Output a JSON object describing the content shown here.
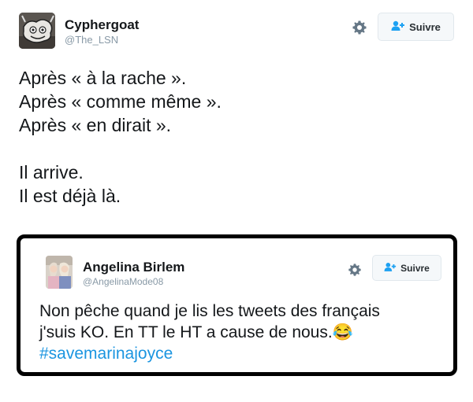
{
  "tweet": {
    "user": {
      "name": "Cyphergoat",
      "handle": "@The_LSN"
    },
    "follow_label": "Suivre",
    "lines": [
      "Après « à la rache ».",
      "Après « comme même ».",
      "Après « en dirait ».",
      "",
      "Il arrive.",
      "Il est déjà là."
    ]
  },
  "quoted_tweet": {
    "user": {
      "name": "Angelina Birlem",
      "handle": "@AngelinaMode08"
    },
    "follow_label": "Suivre",
    "lines": [
      "Non pêche quand je lis les tweets des français",
      "j'suis KO. En TT le HT a cause de nous."
    ],
    "emoji": "😂",
    "hashtag": "#savemarinajoyce"
  },
  "colors": {
    "hashtag": "#1b95e0",
    "handle": "#8899a6",
    "follow_icon": "#1da1f2",
    "card_border": "#000000"
  },
  "icons": {
    "gear": "gear-icon",
    "follow": "add-user-icon"
  }
}
